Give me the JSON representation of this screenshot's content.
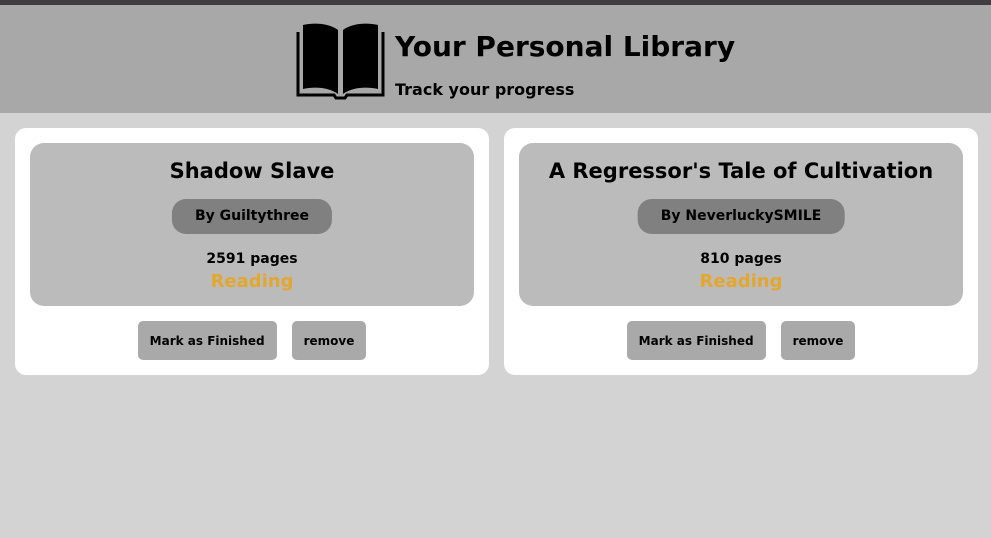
{
  "header": {
    "title": "Your Personal Library",
    "subtitle": "Track your progress",
    "logo_icon": "open-book-icon"
  },
  "books": [
    {
      "title": "Shadow Slave",
      "author": "By Guiltythree",
      "pages": "2591 pages",
      "status": "Reading",
      "finish_label": "Mark as Finished",
      "remove_label": "remove"
    },
    {
      "title": "A Regressor's Tale of Cultivation",
      "author": "By NeverluckySMILE",
      "pages": "810 pages",
      "status": "Reading",
      "finish_label": "Mark as Finished",
      "remove_label": "remove"
    }
  ],
  "colors": {
    "page_background": "#d3d3d3",
    "header_background": "#a8a8a8",
    "card_background": "#ffffff",
    "card_info_background": "#bbbbbb",
    "author_pill": "#808080",
    "button": "#a9a9a9",
    "status_reading": "#e3a72f"
  }
}
